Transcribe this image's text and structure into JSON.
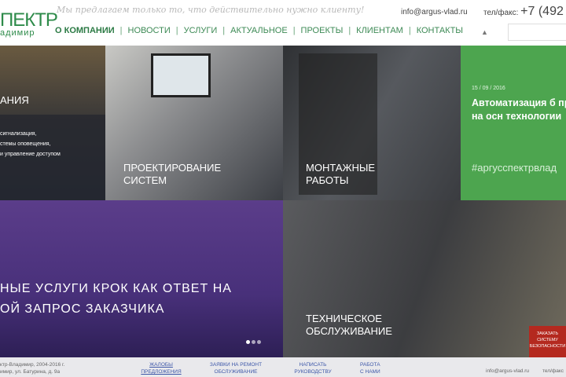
{
  "header": {
    "logo_top": "ПЕКТР",
    "logo_bottom": "адимир",
    "slogan": "Мы предлагаем только то, что действительно нужно клиенту!",
    "email": "info@argus-vlad.ru",
    "phone_label": "тел/факс:",
    "phone": "+7 (492",
    "nav": [
      "О КОМПАНИИ",
      "НОВОСТИ",
      "УСЛУГИ",
      "АКТУАЛЬНОЕ",
      "ПРОЕКТЫ",
      "КЛИЕНТАМ",
      "КОНТАКТЫ"
    ],
    "separator": "|"
  },
  "tiles": {
    "t1": {
      "title": "АНИЯ",
      "lines": [
        "сигнализация,",
        "стемы оповещения,",
        "и управление доступом"
      ]
    },
    "t2": {
      "title": "ПРОЕКТИРОВАНИЕ СИСТЕМ"
    },
    "t3": {
      "title": "МОНТАЖНЫЕ РАБОТЫ"
    },
    "t4": {
      "date": "15 / 09 / 2016",
      "title": "Автоматизация б процессов на осн технологии",
      "hashtag": "#аргусспектрвлад"
    },
    "t5": {
      "title": "НЫЕ УСЛУГИ КРОК КАК ОТВЕТ НА ОЙ ЗАПРОС ЗАКАЗЧИКА"
    },
    "t6": {
      "title": "ТЕХНИЧЕСКОЕ ОБСЛУЖИВАНИЕ",
      "badge": "ЗАКАЗАТЬ СИСТЕМУ БЕЗОПАСНОСТИ"
    }
  },
  "footer": {
    "copyright": "ктр-Владимир, 2004-2016 г.",
    "address": "имир, ул. Батурина, д. 9а",
    "links": [
      "ЖАЛОБЫ ПРЕДЛОЖЕНИЯ",
      "ЗАЯВКИ НА РЕМОНТ ОБСЛУЖИВАНИЕ",
      "НАПИСАТЬ РУКОВОДСТВУ",
      "РАБОТА С НАМИ"
    ],
    "email": "info@argus-vlad.ru",
    "phone_label": "тел/факс"
  }
}
